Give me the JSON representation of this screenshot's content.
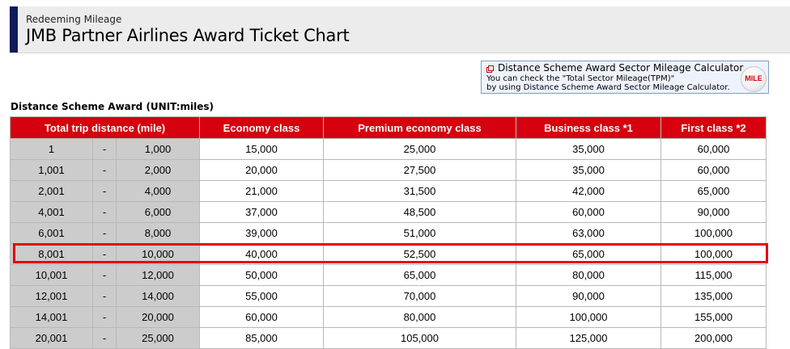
{
  "header": {
    "subtitle": "Redeeming Mileage",
    "title": "JMB Partner Airlines Award Ticket Chart"
  },
  "calculator": {
    "link_label": "Distance Scheme Award Sector Mileage Calculator",
    "line1": "You can check the \"Total Sector Mileage(TPM)\"",
    "line2": "by using Distance Scheme Award Sector Mileage Calculator.",
    "badge": "MILE",
    "icon": "external-window-icon"
  },
  "section_title": "Distance Scheme Award (UNIT:miles)",
  "table": {
    "headers": [
      "Total trip distance (mile)",
      "Economy class",
      "Premium economy class",
      "Business class *1",
      "First class *2"
    ],
    "rows": [
      {
        "from": "1",
        "sep": "-",
        "to": "1,000",
        "economy": "15,000",
        "premium": "25,000",
        "business": "35,000",
        "first": "60,000"
      },
      {
        "from": "1,001",
        "sep": "-",
        "to": "2,000",
        "economy": "20,000",
        "premium": "27,500",
        "business": "35,000",
        "first": "60,000"
      },
      {
        "from": "2,001",
        "sep": "-",
        "to": "4,000",
        "economy": "21,000",
        "premium": "31,500",
        "business": "42,000",
        "first": "65,000"
      },
      {
        "from": "4,001",
        "sep": "-",
        "to": "6,000",
        "economy": "37,000",
        "premium": "48,500",
        "business": "60,000",
        "first": "90,000"
      },
      {
        "from": "6,001",
        "sep": "-",
        "to": "8,000",
        "economy": "39,000",
        "premium": "51,000",
        "business": "63,000",
        "first": "100,000"
      },
      {
        "from": "8,001",
        "sep": "-",
        "to": "10,000",
        "economy": "40,000",
        "premium": "52,500",
        "business": "65,000",
        "first": "100,000"
      },
      {
        "from": "10,001",
        "sep": "-",
        "to": "12,000",
        "economy": "50,000",
        "premium": "65,000",
        "business": "80,000",
        "first": "115,000"
      },
      {
        "from": "12,001",
        "sep": "-",
        "to": "14,000",
        "economy": "55,000",
        "premium": "70,000",
        "business": "90,000",
        "first": "135,000"
      },
      {
        "from": "14,001",
        "sep": "-",
        "to": "20,000",
        "economy": "60,000",
        "premium": "80,000",
        "business": "100,000",
        "first": "155,000"
      },
      {
        "from": "20,001",
        "sep": "-",
        "to": "25,000",
        "economy": "85,000",
        "premium": "105,000",
        "business": "125,000",
        "first": "200,000"
      }
    ]
  },
  "colors": {
    "header_bar": "#0e1a5c",
    "table_header": "#d6000f",
    "highlight_border": "#e60012",
    "distance_cell": "#cccccc"
  }
}
